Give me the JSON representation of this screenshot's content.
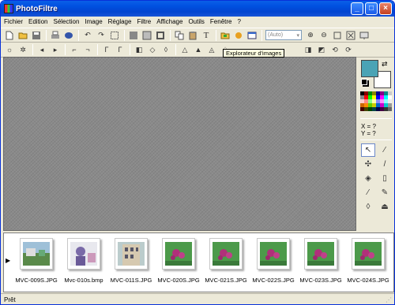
{
  "window": {
    "title": "PhotoFiltre",
    "minimize": "_",
    "maximize": "□",
    "close": "×"
  },
  "menu": [
    "Fichier",
    "Edition",
    "Sélection",
    "Image",
    "Réglage",
    "Filtre",
    "Affichage",
    "Outils",
    "Fenêtre",
    "?"
  ],
  "toolbar": {
    "zoom_value": "(Auto)",
    "tooltip": "Explorateur d'images"
  },
  "palette": {
    "foreground_color": "#4aa3b5",
    "background_color": "#ffffff",
    "x_label": "X = ?",
    "y_label": "Y = ?"
  },
  "explorer": {
    "files": [
      {
        "name": "MVC-009S.JPG",
        "icon": "photo-garden"
      },
      {
        "name": "Mvc-010s.bmp",
        "icon": "photo-person"
      },
      {
        "name": "MVC-011S.JPG",
        "icon": "photo-building"
      },
      {
        "name": "MVC-020S.JPG",
        "icon": "photo-flowers"
      },
      {
        "name": "MVC-021S.JPG",
        "icon": "photo-flowers"
      },
      {
        "name": "MVC-022S.JPG",
        "icon": "photo-flowers"
      },
      {
        "name": "MVC-023S.JPG",
        "icon": "photo-flowers"
      },
      {
        "name": "MVC-024S.JPG",
        "icon": "photo-flowers"
      }
    ]
  },
  "status": {
    "text": "Prêt"
  }
}
